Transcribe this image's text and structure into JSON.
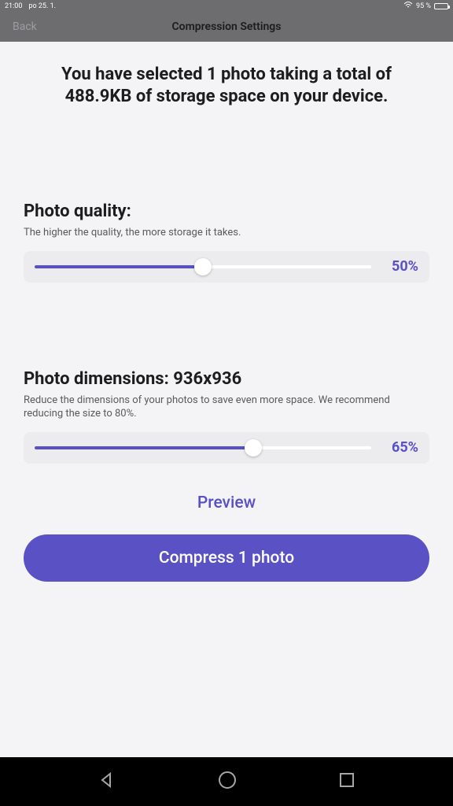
{
  "status": {
    "time": "21:00",
    "date": "po 25. 1.",
    "battery": "95 %"
  },
  "nav": {
    "back": "Back",
    "title": "Compression Settings"
  },
  "headline": "You have selected 1 photo taking a total of 488.9KB of storage space on your device.",
  "quality": {
    "title": "Photo quality:",
    "sub": "The higher the quality, the more storage it takes.",
    "value": 50,
    "value_label": "50%"
  },
  "dimensions": {
    "title": "Photo dimensions: 936x936",
    "sub": "Reduce the dimensions of your photos to save even more space. We recommend reducing the size to 80%.",
    "value": 65,
    "value_label": "65%"
  },
  "preview": "Preview",
  "compress": "Compress 1 photo"
}
